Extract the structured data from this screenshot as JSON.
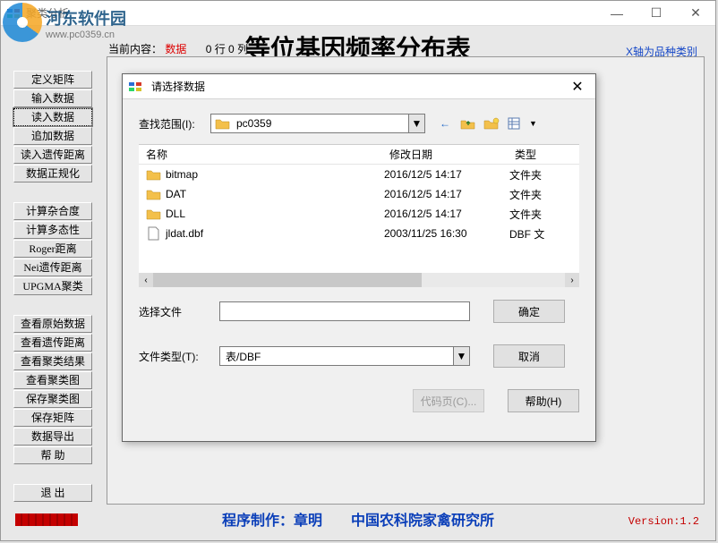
{
  "main": {
    "title": "聚类分析",
    "status_label": "当前内容：",
    "status_value": "数据",
    "status_rows": "0 行 0 列",
    "heading": "等位基因频率分布表",
    "x_note": "X轴为品种类别",
    "bottom_credit": "程序制作：章明　　中国农科院家禽研究所",
    "version": "Version:1.2",
    "watermark_name": "河东软件园",
    "watermark_url": "www.pc0359.cn"
  },
  "sidebar": {
    "g1": [
      "定义矩阵",
      "输入数据",
      "读入数据",
      "追加数据",
      "读入遗传距离",
      "数据正规化"
    ],
    "g2": [
      "计算杂合度",
      "计算多态性",
      "Roger距离",
      "Nei遗传距离",
      "UPGMA聚类"
    ],
    "g3": [
      "查看原始数据",
      "查看遗传距离",
      "查看聚类结果",
      "查看聚类图",
      "保存聚类图",
      "保存矩阵",
      "数据导出",
      "帮 助"
    ],
    "g4": [
      "退 出"
    ]
  },
  "dialog": {
    "title": "请选择数据",
    "lookin_label": "查找范围(I):",
    "lookin_value": "pc0359",
    "cols": {
      "name": "名称",
      "date": "修改日期",
      "type": "类型"
    },
    "files": [
      {
        "icon": "folder",
        "name": "bitmap",
        "date": "2016/12/5 14:17",
        "type": "文件夹"
      },
      {
        "icon": "folder",
        "name": "DAT",
        "date": "2016/12/5 14:17",
        "type": "文件夹"
      },
      {
        "icon": "folder",
        "name": "DLL",
        "date": "2016/12/5 14:17",
        "type": "文件夹"
      },
      {
        "icon": "file",
        "name": "jldat.dbf",
        "date": "2003/11/25 16:30",
        "type": "DBF 文"
      }
    ],
    "select_label": "选择文件",
    "select_value": "",
    "filetype_label": "文件类型(T):",
    "filetype_value": "表/DBF",
    "ok": "确定",
    "cancel": "取消",
    "help": "帮助(H)",
    "codepage": "代码页(C)..."
  },
  "icons": {
    "back_arrow": "←",
    "dropdown": "▼",
    "left": "‹",
    "right": "›",
    "close": "✕",
    "minimize": "—",
    "maximize": "☐"
  }
}
